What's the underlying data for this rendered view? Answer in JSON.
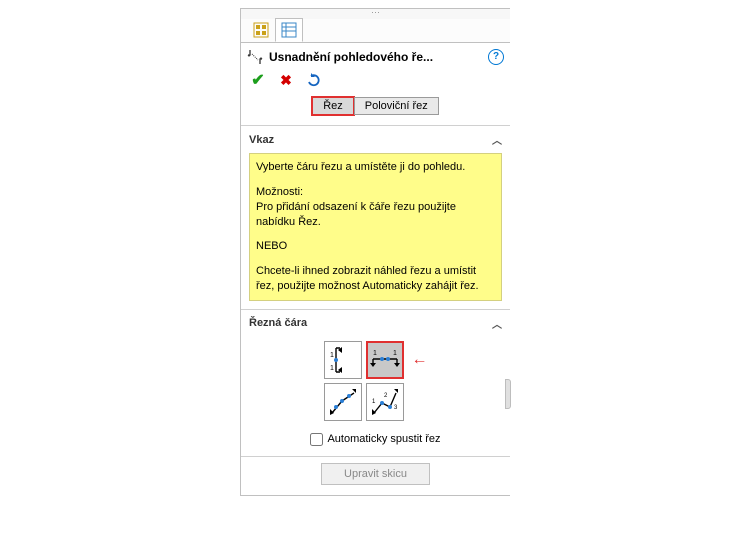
{
  "header": {
    "title": "Usnadnění pohledového ře..."
  },
  "segmented": {
    "rez": "Řez",
    "half": "Poloviční řez"
  },
  "sections": {
    "vkaz_label": "Vkaz",
    "rezna_label": "Řezná čára"
  },
  "message": {
    "line1": "Vyberte čáru řezu a umístěte ji do pohledu.",
    "opts_label": "Možnosti:",
    "opts_body": "Pro přidání odsazení k čáře řezu použijte nabídku Řez.",
    "or_label": "NEBO",
    "line2": "Chcete-li ihned zobrazit náhled řezu a umístit řez, použijte možnost Automaticky zahájit řez."
  },
  "checkbox": {
    "auto_start": "Automaticky spustit řez"
  },
  "buttons": {
    "edit_sketch": "Upravit skicu"
  },
  "cut_icons": [
    "vertical-offset",
    "horizontal-offset",
    "aligned",
    "three-point"
  ]
}
